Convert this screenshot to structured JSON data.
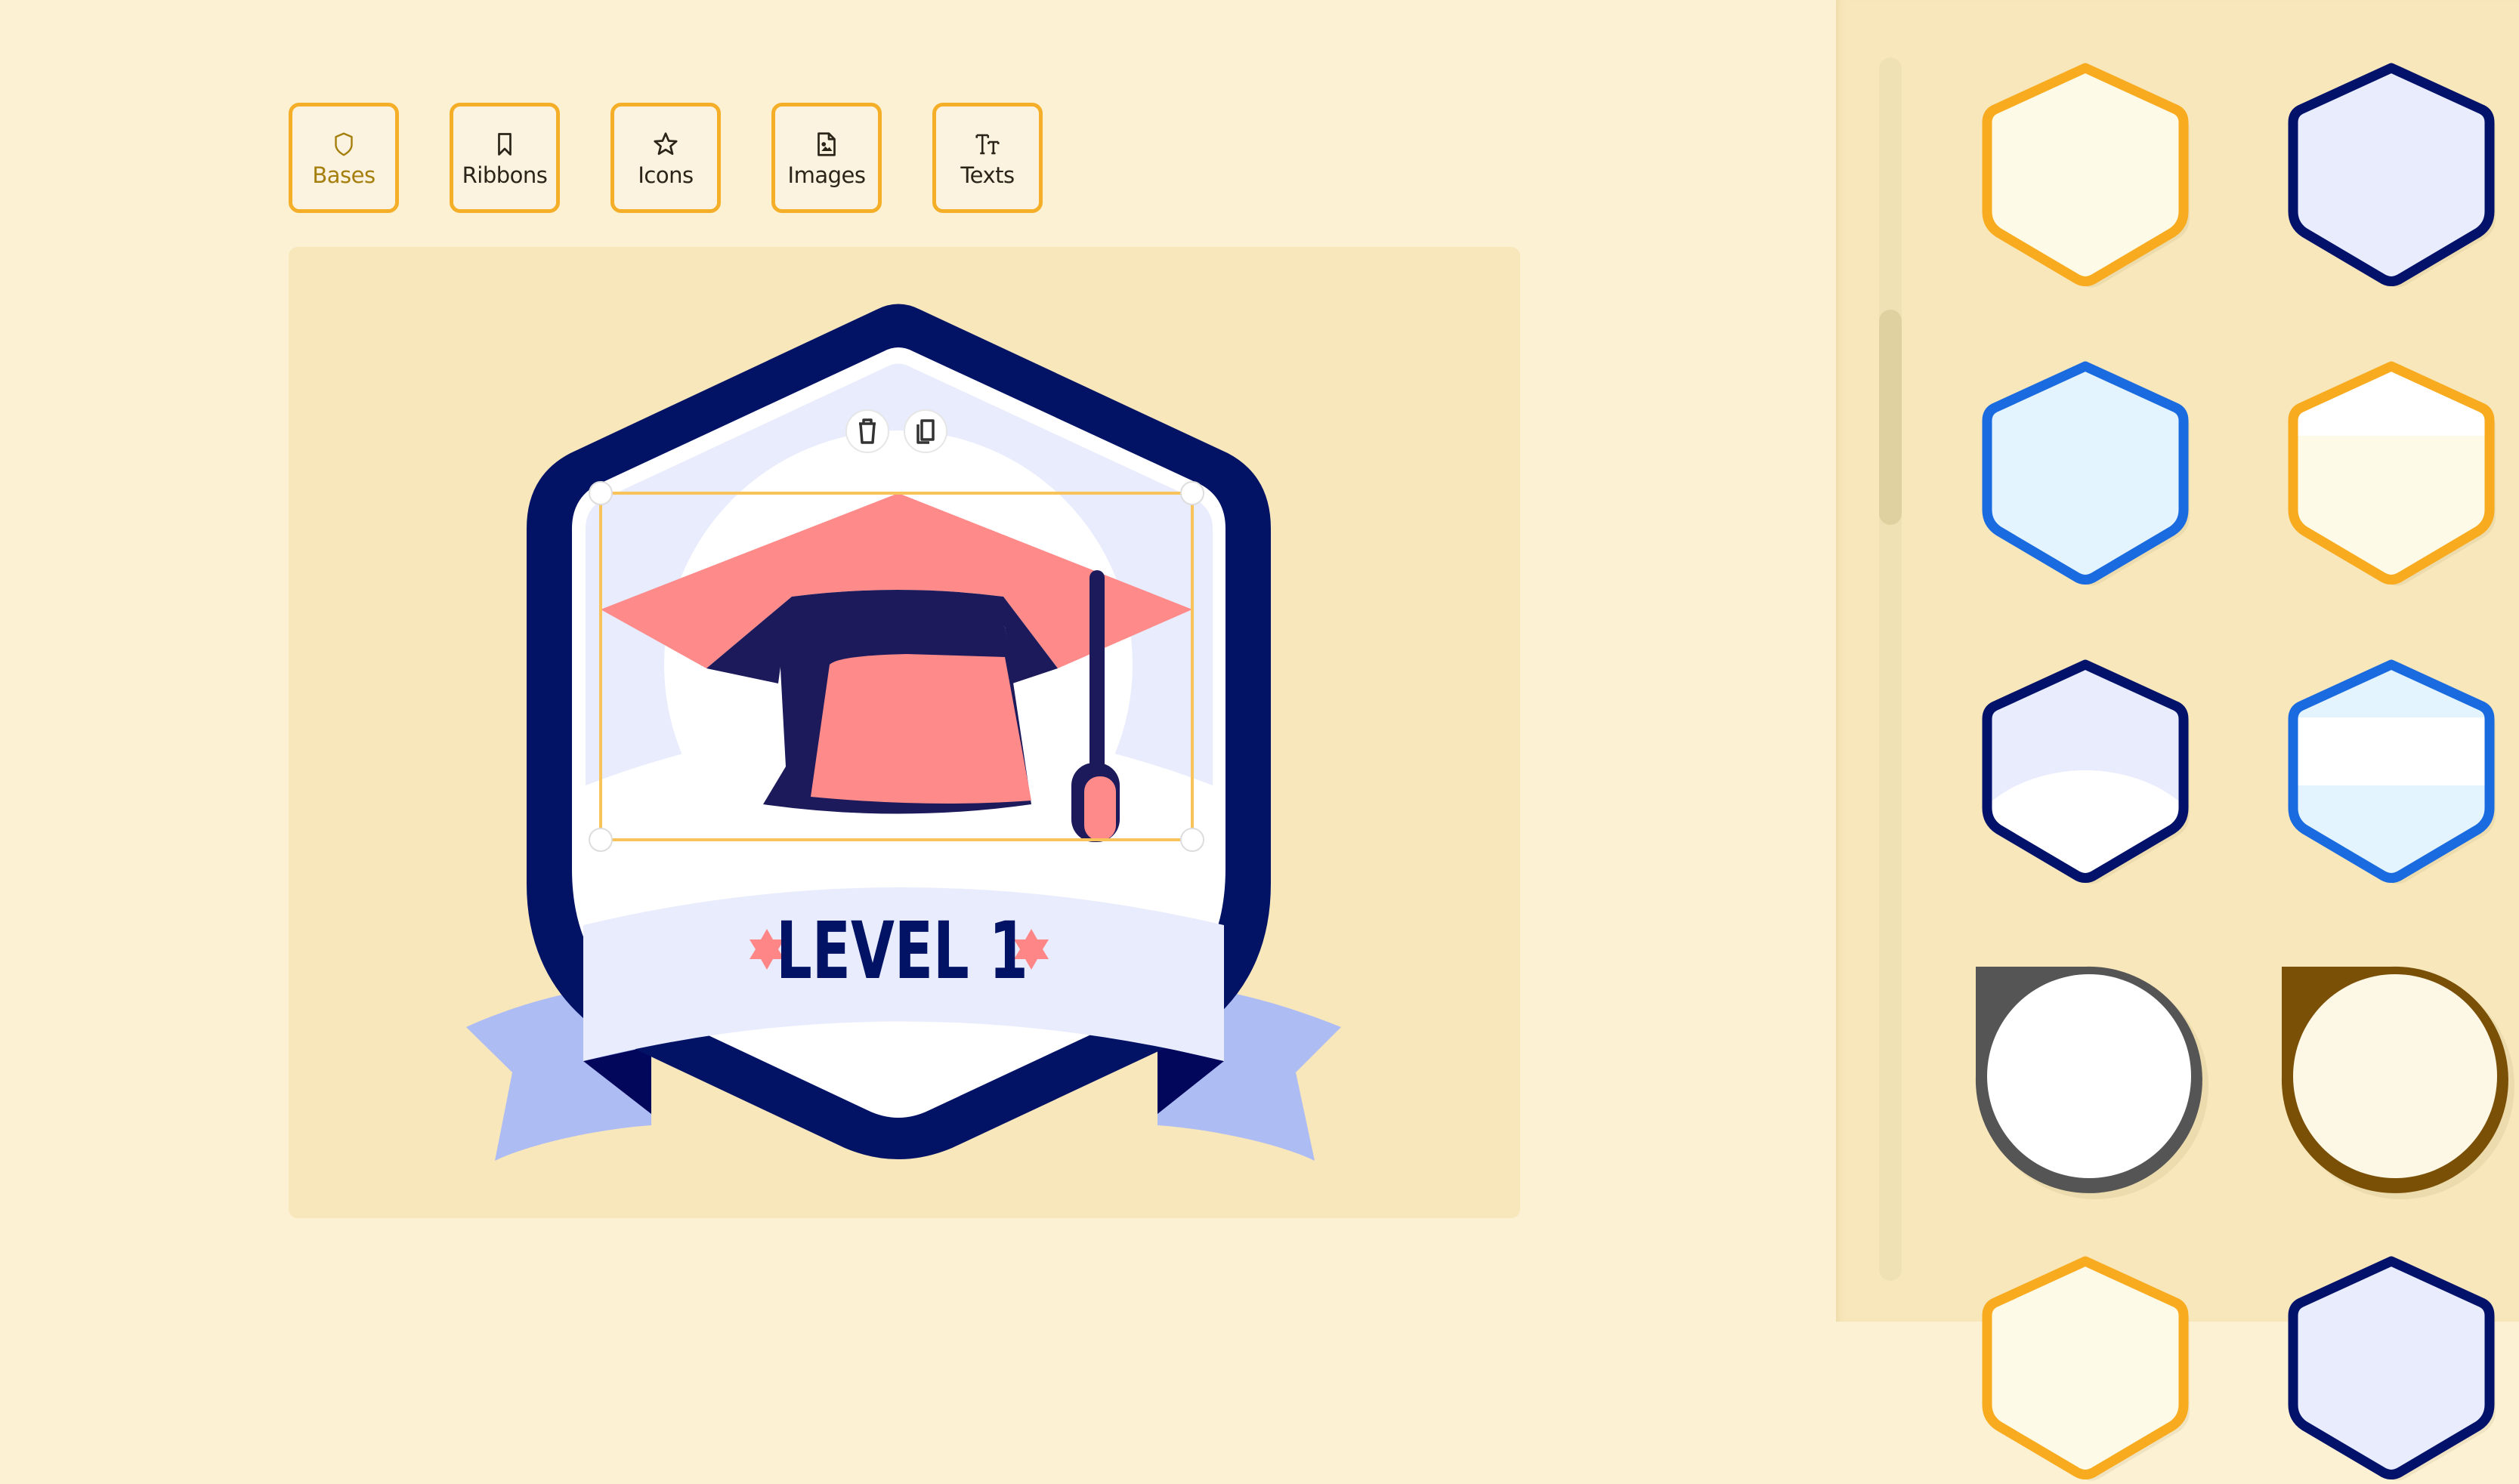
{
  "toolbar": {
    "tabs": [
      {
        "label": "Bases",
        "icon": "shield-icon",
        "active": true
      },
      {
        "label": "Ribbons",
        "icon": "bookmark-icon",
        "active": false
      },
      {
        "label": "Icons",
        "icon": "star-icon",
        "active": false
      },
      {
        "label": "Images",
        "icon": "image-file-icon",
        "active": false
      },
      {
        "label": "Texts",
        "icon": "text-size-icon",
        "active": false
      }
    ]
  },
  "canvas": {
    "badge": {
      "title_text": "LEVEL 1",
      "icon": "graduation-cap-icon",
      "colors": {
        "shield_border": "#021366",
        "shield_fill": "#e8ecfd",
        "inner_white": "#ffffff",
        "cap_primary": "#ff8a8a",
        "cap_dark": "#1d1a5c",
        "ribbon_front": "#e8ecfd",
        "ribbon_back": "#aebcf4",
        "ribbon_fold": "#02075c",
        "star": "#ff8686"
      }
    },
    "selection": {
      "actions": [
        {
          "name": "delete",
          "icon": "trash-icon"
        },
        {
          "name": "duplicate",
          "icon": "copy-icon"
        }
      ]
    }
  },
  "bases_panel": {
    "items": [
      {
        "shape": "circle-tab",
        "stroke": "#555555",
        "fill": "#ffffff",
        "style": "plain",
        "partial": "top"
      },
      {
        "shape": "circle-tab",
        "stroke": "#7a4f06",
        "fill": "#fdf8e6",
        "style": "plain",
        "partial": "top"
      },
      {
        "shape": "hexagon",
        "stroke": "#f8ab1f",
        "fill": "#fefae8",
        "style": "plain"
      },
      {
        "shape": "hexagon",
        "stroke": "#02126a",
        "fill": "#e8ecfd",
        "style": "plain"
      },
      {
        "shape": "hexagon",
        "stroke": "#1a6ae0",
        "fill": "#e4f4ff",
        "style": "plain"
      },
      {
        "shape": "hexagon",
        "stroke": "#f8ab1f",
        "fill": "#fefae8",
        "style": "top-white"
      },
      {
        "shape": "hexagon",
        "stroke": "#02126a",
        "fill": "#e8ecfd",
        "style": "bottom-arc"
      },
      {
        "shape": "hexagon",
        "stroke": "#1a6ae0",
        "fill": "#e4f4ff",
        "style": "band"
      },
      {
        "shape": "circle-tab",
        "stroke": "#555555",
        "fill": "#ffffff",
        "style": "plain"
      },
      {
        "shape": "circle-tab",
        "stroke": "#7a4f06",
        "fill": "#fdf8e6",
        "style": "plain"
      },
      {
        "shape": "hexagon",
        "stroke": "#f8ab1f",
        "fill": "#fefae8",
        "style": "plain",
        "partial": "bottom"
      },
      {
        "shape": "hexagon",
        "stroke": "#02126a",
        "fill": "#e8ecfd",
        "style": "plain",
        "partial": "bottom"
      }
    ],
    "scroll_position": 0.25
  }
}
